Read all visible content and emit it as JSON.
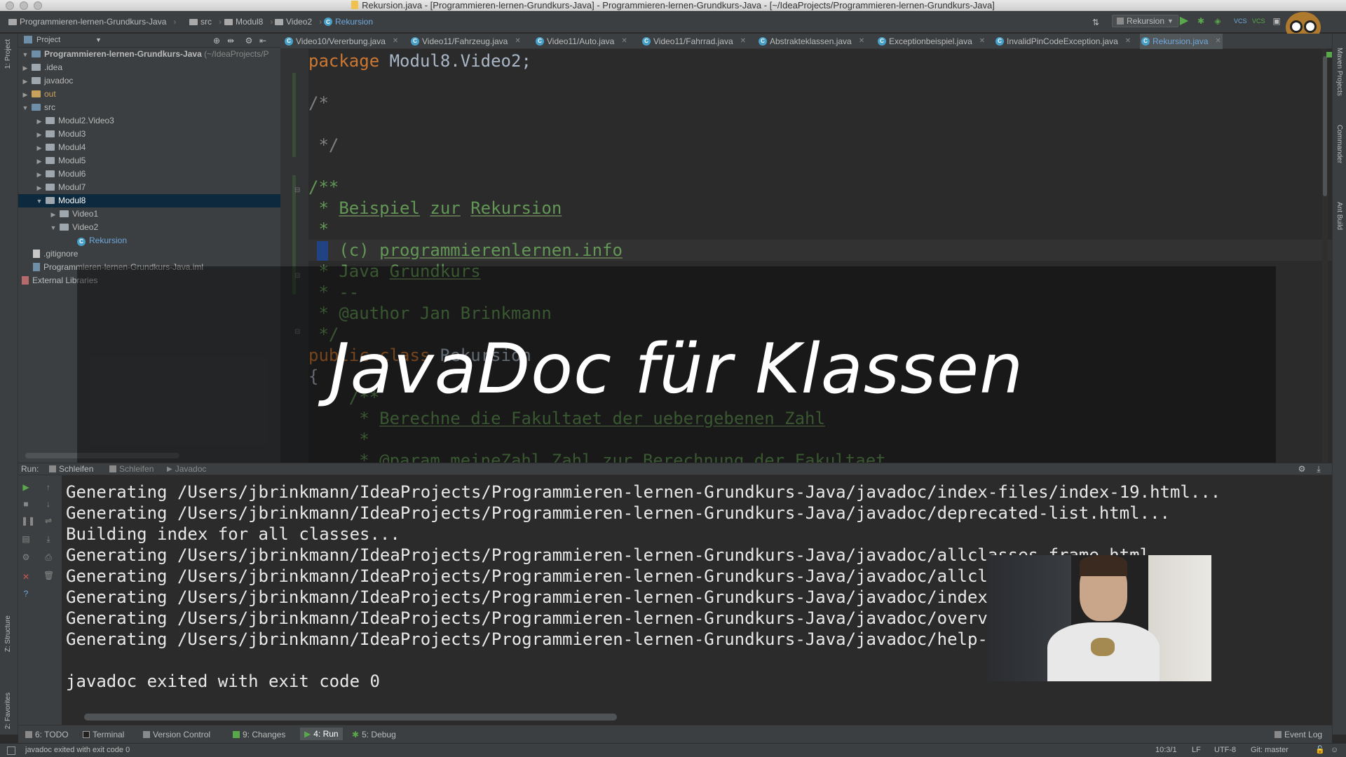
{
  "window": {
    "title": "Rekursion.java - [Programmieren-lernen-Grundkurs-Java] - Programmieren-lernen-Grundkurs-Java - [~/IdeaProjects/Programmieren-lernen-Grundkurs-Java]"
  },
  "navbar": {
    "crumbs": [
      "Programmieren-lernen-Grundkurs-Java",
      "src",
      "Modul8",
      "Video2",
      "Rekursion"
    ],
    "run_config": "Rekursion"
  },
  "project": {
    "header": "Project",
    "tree": [
      {
        "label": "Programmieren-lernen-Grundkurs-Java",
        "suffix": "(~/IdeaProjects/P",
        "depth": 0
      },
      {
        "label": ".idea",
        "depth": 1
      },
      {
        "label": "javadoc",
        "depth": 1
      },
      {
        "label": "out",
        "depth": 1
      },
      {
        "label": "src",
        "depth": 1
      },
      {
        "label": "Modul2.Video3",
        "depth": 2
      },
      {
        "label": "Modul3",
        "depth": 2
      },
      {
        "label": "Modul4",
        "depth": 2
      },
      {
        "label": "Modul5",
        "depth": 2
      },
      {
        "label": "Modul6",
        "depth": 2
      },
      {
        "label": "Modul7",
        "depth": 2
      },
      {
        "label": "Modul8",
        "depth": 2
      },
      {
        "label": "Video1",
        "depth": 3
      },
      {
        "label": "Video2",
        "depth": 3
      },
      {
        "label": "Rekursion",
        "depth": 4
      },
      {
        "label": ".gitignore",
        "depth": 1
      },
      {
        "label": "Programmieren-lernen-Grundkurs-Java.iml",
        "depth": 1
      },
      {
        "label": "External Libraries",
        "depth": 0
      }
    ]
  },
  "left_stripe": {
    "project": "1: Project",
    "structure": "Z: Structure",
    "favorites": "2: Favorites"
  },
  "right_stripe": {
    "maven": "Maven Projects",
    "commander": "Commander",
    "ant": "Ant Build"
  },
  "tabs": [
    "Video10/Vererbung.java",
    "Video11/Fahrzeug.java",
    "Video11/Auto.java",
    "Video11/Fahrrad.java",
    "Abstrakteklassen.java",
    "Exceptionbeispiel.java",
    "InvalidPinCodeException.java",
    "Rekursion.java"
  ],
  "code": {
    "l1_kw": "package",
    "l1_rest": " Modul8.Video2;",
    "l2": "/*",
    "l3": " */",
    "l4": "/**",
    "l5a": " * ",
    "l5b": "Beispiel",
    "l5c": " ",
    "l5d": "zur",
    "l5e": " ",
    "l5f": "Rekursion",
    "l6": " *",
    "l7a": " * (c) ",
    "l7b": "programmierenlernen.info",
    "l8a": " * Java ",
    "l8b": "Grundkurs",
    "l9": " * --",
    "l10": " * @author Jan Brinkmann",
    "l11": " */",
    "l12_kw": "public class",
    "l12_rest": " Rekursion",
    "l13": "{",
    "l14": "    /**",
    "l15a": "     * ",
    "l15b": "Berechne die Fakultaet der uebergebenen Zahl",
    "l16": "     *",
    "l17": "     * @param meineZahl Zahl zur Berechnung der Fakultaet"
  },
  "overlay": {
    "title": "JavaDoc für Klassen"
  },
  "run": {
    "label": "Run:",
    "tabs": [
      "Schleifen",
      "Schleifen",
      "Javadoc"
    ],
    "lines": [
      "Generating /Users/jbrinkmann/IdeaProjects/Programmieren-lernen-Grundkurs-Java/javadoc/index-files/index-19.html...",
      "Generating /Users/jbrinkmann/IdeaProjects/Programmieren-lernen-Grundkurs-Java/javadoc/deprecated-list.html...",
      "Building index for all classes...",
      "Generating /Users/jbrinkmann/IdeaProjects/Programmieren-lernen-Grundkurs-Java/javadoc/allclasses-frame.html...",
      "Generating /Users/jbrinkmann/IdeaProjects/Programmieren-lernen-Grundkurs-Java/javadoc/allclasses-noframe.html...",
      "Generating /Users/jbrinkmann/IdeaProjects/Programmieren-lernen-Grundkurs-Java/javadoc/index.html...",
      "Generating /Users/jbrinkmann/IdeaProjects/Programmieren-lernen-Grundkurs-Java/javadoc/overview-summary.html...",
      "Generating /Users/jbrinkmann/IdeaProjects/Programmieren-lernen-Grundkurs-Java/javadoc/help-doc.html...",
      "",
      "javadoc exited with exit code 0"
    ]
  },
  "toolbar": {
    "todo": "6: TODO",
    "terminal": "Terminal",
    "vcs": "Version Control",
    "changes": "9: Changes",
    "run": "4: Run",
    "debug": "5: Debug",
    "eventlog": "Event Log"
  },
  "status": {
    "message": "javadoc exited with exit code 0",
    "position": "10:3/1",
    "line_sep": "LF",
    "encoding": "UTF-8",
    "git": "Git: master"
  }
}
